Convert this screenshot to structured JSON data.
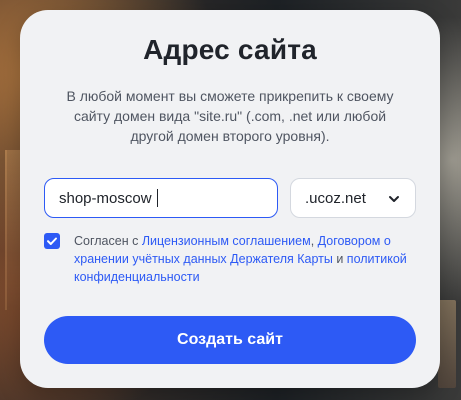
{
  "modal": {
    "title": "Адрес сайта",
    "description": "В любой момент вы сможете прикрепить к своему сайту домен вида \"site.ru\" (.com, .net или любой другой домен второго уровня)."
  },
  "domain": {
    "value": "shop-moscow",
    "zone_value": "ucoz.net",
    "zone_prefix": ".",
    "chevron_icon": "chevron-down-icon"
  },
  "agreement": {
    "checked": true,
    "checkbox_icon": "checkmark-icon",
    "prefix": "Согласен с ",
    "link1": "Лицензионным соглашением",
    "separator": ", ",
    "link2": "Договором о хранении учётных данных Держателя Карты",
    "conjunction": " и ",
    "link3": "политикой конфиденциальности"
  },
  "buttons": {
    "create": "Создать сайт"
  },
  "colors": {
    "accent": "#2d5af5",
    "card_bg": "#f1f2f4",
    "text_dark": "#20242b",
    "text_muted": "#4f5561"
  }
}
